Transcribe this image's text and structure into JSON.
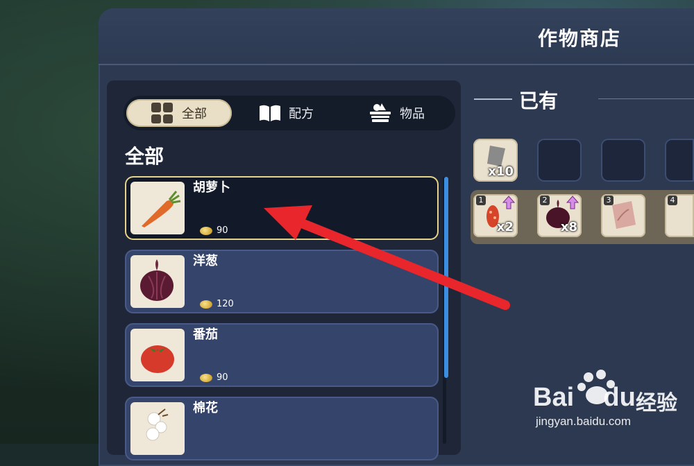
{
  "shop": {
    "title": "作物商店"
  },
  "tabs": [
    {
      "label": "全部",
      "icon": "grid-icon",
      "active": true
    },
    {
      "label": "配方",
      "icon": "book-icon",
      "active": false
    },
    {
      "label": "物品",
      "icon": "basket-icon",
      "active": false
    }
  ],
  "section": {
    "title": "全部"
  },
  "items": [
    {
      "name": "胡萝卜",
      "price": "90",
      "icon": "carrot-icon",
      "selected": true
    },
    {
      "name": "洋葱",
      "price": "120",
      "icon": "onion-icon",
      "selected": false
    },
    {
      "name": "番茄",
      "price": "90",
      "icon": "tomato-icon",
      "selected": false
    },
    {
      "name": "棉花",
      "price": "",
      "icon": "cotton-icon",
      "selected": false
    }
  ],
  "owned": {
    "title": "已有",
    "slots": [
      {
        "qty": "x10",
        "icon": "seed-bag-icon"
      },
      {
        "qty": ""
      },
      {
        "qty": ""
      },
      {
        "qty": ""
      }
    ]
  },
  "bag": [
    {
      "num": "1",
      "qty": "x2",
      "icon": "red-seeds-icon",
      "upgrade": true
    },
    {
      "num": "2",
      "qty": "x8",
      "icon": "onion-icon",
      "upgrade": true
    },
    {
      "num": "3",
      "qty": "",
      "icon": "seed-packet-icon",
      "upgrade": false
    },
    {
      "num": "4",
      "qty": "",
      "icon": "",
      "upgrade": false
    }
  ],
  "watermark": {
    "brand": "Bai",
    "brand2": "du",
    "suffix": "经验",
    "url": "jingyan.baidu.com"
  },
  "colors": {
    "accent_selected": "#e7d38a",
    "scroll": "#3b8ee0",
    "arrow": "#e8262b"
  }
}
